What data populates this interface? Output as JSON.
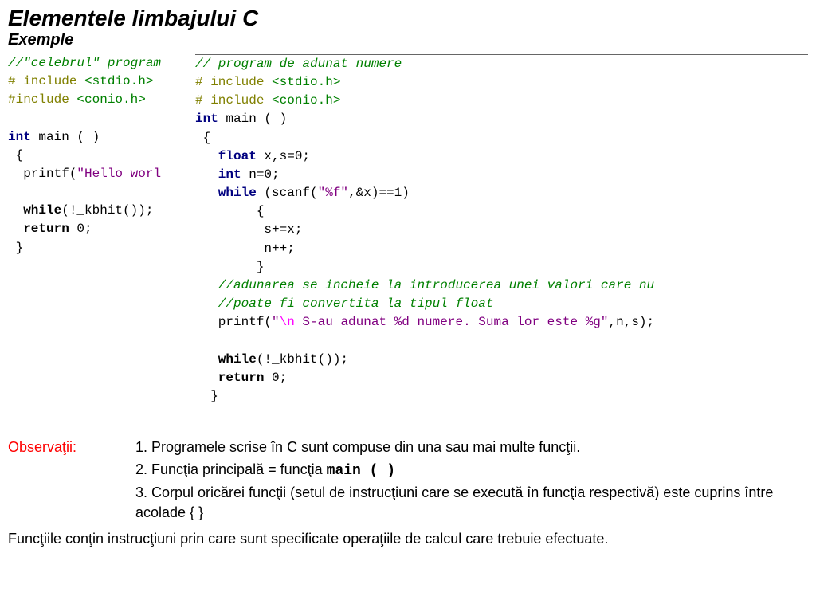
{
  "title": "Elementele limbajului C",
  "subtitle": "Exemple",
  "codeL": {
    "c1": "//\"celebrul\" program",
    "l2a": "# include ",
    "l2b": "<stdio.h>",
    "l3a": "#include ",
    "l3b": "<conio.h>",
    "blank": "",
    "l4a": "int",
    "l4b": " main ( )",
    "l5": " {",
    "l6a": "  printf(",
    "l6b": "\"Hello worl",
    "l7": "",
    "l8a": "  while",
    "l8b": "(!_kbhit());",
    "l9a": "  return",
    "l9b": " 0;",
    "l10": " }"
  },
  "codeR": {
    "c1": "// program de adunat numere",
    "l2a": "# include ",
    "l2b": "<stdio.h>",
    "l3a": "# include ",
    "l3b": "<conio.h>",
    "l4a": "int",
    "l4b": " main ( )",
    "l5": " {",
    "l6a": "   float",
    "l6b": " x,s=0;",
    "l7a": "   int",
    "l7b": " n=0;",
    "l8a": "   while",
    "l8b": " (scanf(",
    "l8c": "\"%f\"",
    "l8d": ",&x)==1)",
    "l9": "        {",
    "l10": "         s+=x;",
    "l11": "         n++;",
    "l12": "        }",
    "c2": "   //adunarea se incheie la introducerea unei valori care nu",
    "c3": "   //poate fi convertita la tipul float",
    "l13a": "   printf(",
    "l13b": "\"",
    "l13c": "\\n",
    "l13d": " S-au adunat %d numere. Suma lor este %g\"",
    "l13e": ",n,s);",
    "l14": "",
    "l15a": "   while",
    "l15b": "(!_kbhit());",
    "l16a": "   return",
    "l16b": " 0;",
    "l17": "  }"
  },
  "notes": {
    "label": "Observaţii:",
    "n1": "1. Programele scrise în C sunt compuse din una sau mai multe funcţii.",
    "n2a": "2. Funcţia principală = funcţia ",
    "n2b": "main ( )",
    "n3": "3. Corpul oricărei funcţii (setul de instrucţiuni care se execută în funcţia  respectivă) este cuprins între  acolade  {     }",
    "footer": "Funcţiile conţin instrucţiuni prin care sunt specificate operaţiile de calcul care trebuie efectuate."
  }
}
